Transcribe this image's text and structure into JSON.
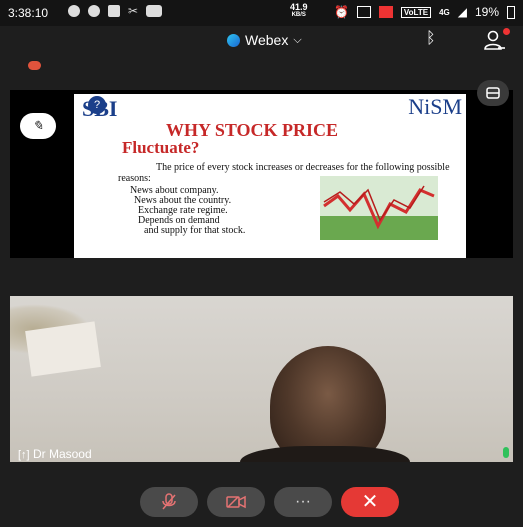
{
  "status_bar": {
    "time": "3:38:10",
    "net_speed": "41.9",
    "net_unit": "KB/S",
    "volte": "VoLTE",
    "signal": "4G",
    "battery": "19%"
  },
  "header": {
    "app_name": "Webex"
  },
  "slide": {
    "logo_left": "SBI",
    "logo_right": "NiSM",
    "title_line1": "WHY STOCK PRICE",
    "title_line2": "Fluctuate?",
    "intro": "The price of every stock increases  or decreases for the following possible reasons:",
    "reasons": [
      "News about company.",
      "News about the country.",
      "Exchange rate regime.",
      "Depends on demand",
      "and supply for that stock."
    ]
  },
  "video": {
    "participant_name": "Dr Masood"
  },
  "colors": {
    "accent_red": "#e53935",
    "mic_green": "#2fc15b",
    "webex_blue": "#1a66d1"
  },
  "controls": [
    {
      "name": "mute-button",
      "icon": "mic-off-icon"
    },
    {
      "name": "camera-button",
      "icon": "video-off-icon"
    },
    {
      "name": "more-button",
      "icon": "more-icon"
    },
    {
      "name": "leave-button",
      "icon": "close-icon"
    }
  ]
}
